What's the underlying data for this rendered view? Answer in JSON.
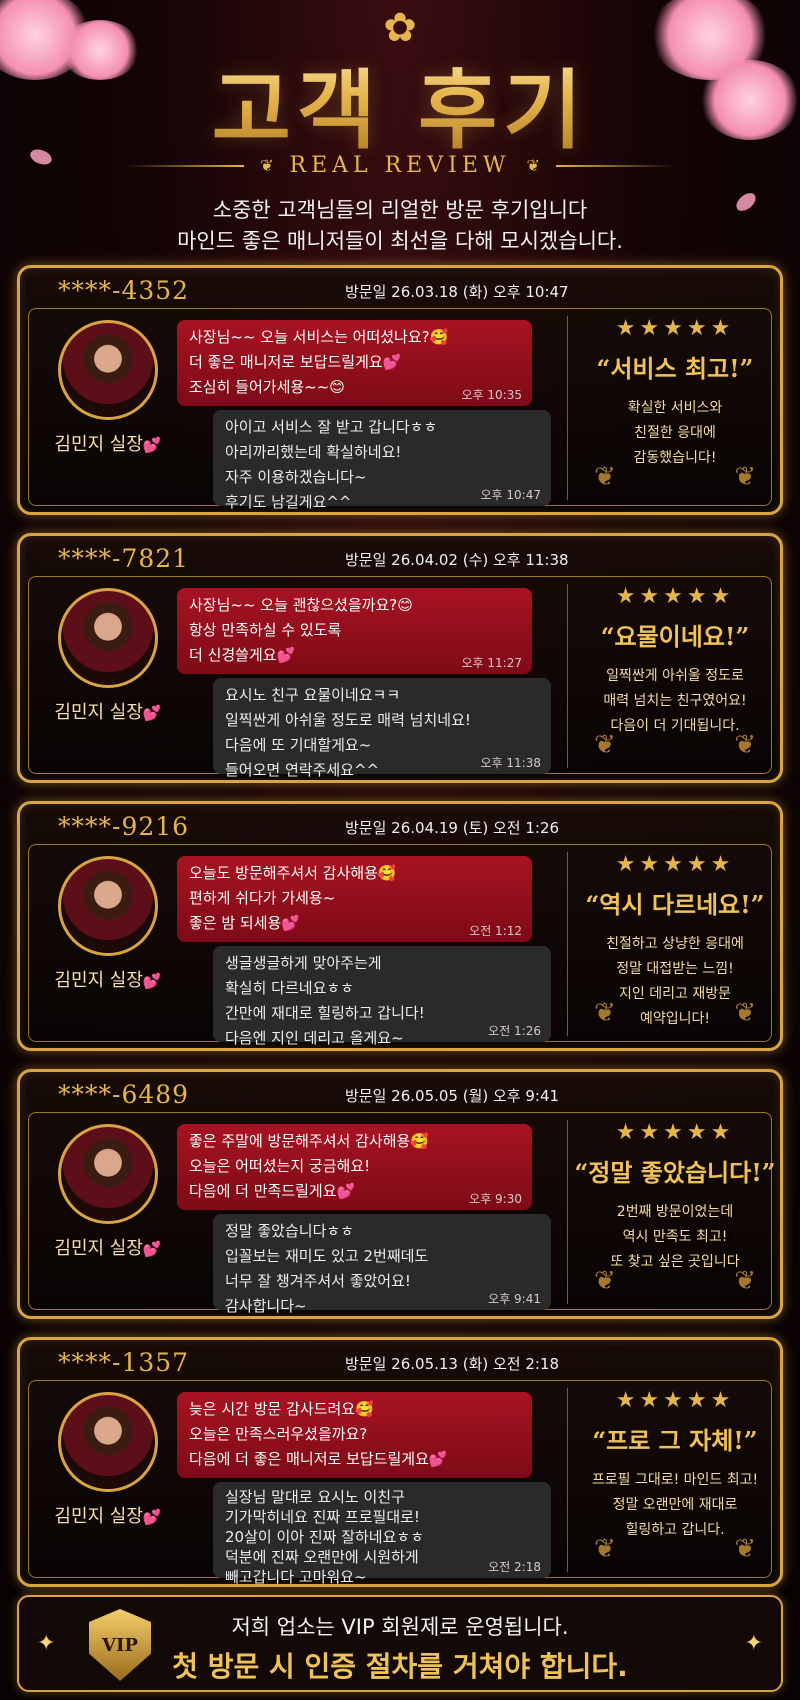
{
  "header": {
    "title": "고객 후기",
    "subtitle": "REAL REVIEW",
    "intro_line1": "소중한 고객님들의 리얼한 방문 후기입니다",
    "intro_line2": "마인드 좋은 매니저들이 최선을 다해 모시겠습니다."
  },
  "reviews": [
    {
      "user_id": "****-4352",
      "visit": "방문일 26.03.18 (화) 오후 10:47",
      "staff": "김민지 실장",
      "staff_msg": [
        "사장님~~ 오늘 서비스는 어떠셨나요?🥰",
        "더 좋은 매니저로 보답드릴게요💕",
        "조심히 들어가세용~~😊"
      ],
      "staff_time": "오후 10:35",
      "customer_msg": [
        "아이고 서비스 잘 받고 갑니다ㅎㅎ",
        "아리까리했는데 확실하네요!",
        "자주 이용하겠습니다~",
        "후기도 남길게요^^"
      ],
      "customer_time": "오후 10:47",
      "stars": "★★★★★",
      "quote": "“서비스 최고!”",
      "text": [
        "확실한 서비스와",
        "친절한 응대에",
        "감동했습니다!"
      ]
    },
    {
      "user_id": "****-7821",
      "visit": "방문일 26.04.02 (수) 오후 11:38",
      "staff": "김민지 실장",
      "staff_msg": [
        "사장님~~ 오늘 괜찮으셨을까요?😊",
        "항상 만족하실 수 있도록",
        "더 신경쓸게요💕"
      ],
      "staff_time": "오후 11:27",
      "customer_msg": [
        "요시노 친구 요물이네요ㅋㅋ",
        "일찍싼게 아쉬울 정도로 매력 넘치네요!",
        "다음에 또 기대할게요~",
        "들어오면 연락주세요^^"
      ],
      "customer_time": "오후 11:38",
      "stars": "★★★★★",
      "quote": "“요물이네요!”",
      "text": [
        "일찍싼게 아쉬울 정도로",
        "매력 넘치는 친구였어요!",
        "다음이 더 기대됩니다."
      ]
    },
    {
      "user_id": "****-9216",
      "visit": "방문일 26.04.19 (토) 오전 1:26",
      "staff": "김민지 실장",
      "staff_msg": [
        "오늘도 방문해주셔서 감사해용🥰",
        "편하게 쉬다가 가세용~",
        "좋은 밤 되세용💕"
      ],
      "staff_time": "오전 1:12",
      "customer_msg": [
        "생글생글하게 맞아주는게",
        "확실히 다르네요ㅎㅎ",
        "간만에 재대로 힐링하고 갑니다!",
        "다음엔 지인 데리고 올게요~"
      ],
      "customer_time": "오전 1:26",
      "stars": "★★★★★",
      "quote": "“역시 다르네요!”",
      "text": [
        "친절하고 상냥한 응대에",
        "정말 대접받는 느낌!",
        "지인 데리고 재방문",
        "예약입니다!"
      ]
    },
    {
      "user_id": "****-6489",
      "visit": "방문일 26.05.05 (월) 오후 9:41",
      "staff": "김민지 실장",
      "staff_msg": [
        "좋은 주말에 방문해주셔서 감사해용🥰",
        "오늘은 어떠셨는지 궁금해요!",
        "다음에 더 만족드릴게요💕"
      ],
      "staff_time": "오후 9:30",
      "customer_msg": [
        "정말 좋았습니다ㅎㅎ",
        "입꼴보는 재미도 있고 2번째데도",
        "너무 잘 챙겨주셔서 좋았어요!",
        "감사합니다~"
      ],
      "customer_time": "오후 9:41",
      "stars": "★★★★★",
      "quote": "“정말 좋았습니다!”",
      "text": [
        "2번째 방문이었는데",
        "역시 만족도 최고!",
        "또 찾고 싶은 곳입니다"
      ]
    },
    {
      "user_id": "****-1357",
      "visit": "방문일 26.05.13 (화) 오전 2:18",
      "staff": "김민지 실장",
      "staff_msg": [
        "늦은 시간 방문 감사드려요🥰",
        "오늘은 만족스러우셨을까요?",
        "다음에 더 좋은 매니저로 보답드릴게요💕"
      ],
      "staff_time": "",
      "customer_msg": [
        "실장님 말대로 요시노 이친구",
        "기가막히네요 진짜 프로필대로!",
        "20살이 이아 진짜 잘하네요ㅎㅎ",
        "덕분에 진짜 오랜만에 시원하게",
        "빼고갑니다 고마워요~"
      ],
      "customer_time": "오전 2:18",
      "stars": "★★★★★",
      "quote": "“프로 그 자체!”",
      "text": [
        "프로필 그대로! 마인드 최고!",
        "정말 오랜만에 재대로",
        "힐링하고 갑니다."
      ]
    }
  ],
  "footer": {
    "badge": "VIP",
    "line1": "저희 업소는 VIP 회원제로 운영됩니다.",
    "line2": "첫 방문 시 인증 절차를 거쳐야 합니다."
  },
  "colors": {
    "gold": "#e6b64d",
    "staff_bubble": "#a81322",
    "customer_bubble": "#2a2a2a",
    "heart": "#ff4fa3"
  }
}
